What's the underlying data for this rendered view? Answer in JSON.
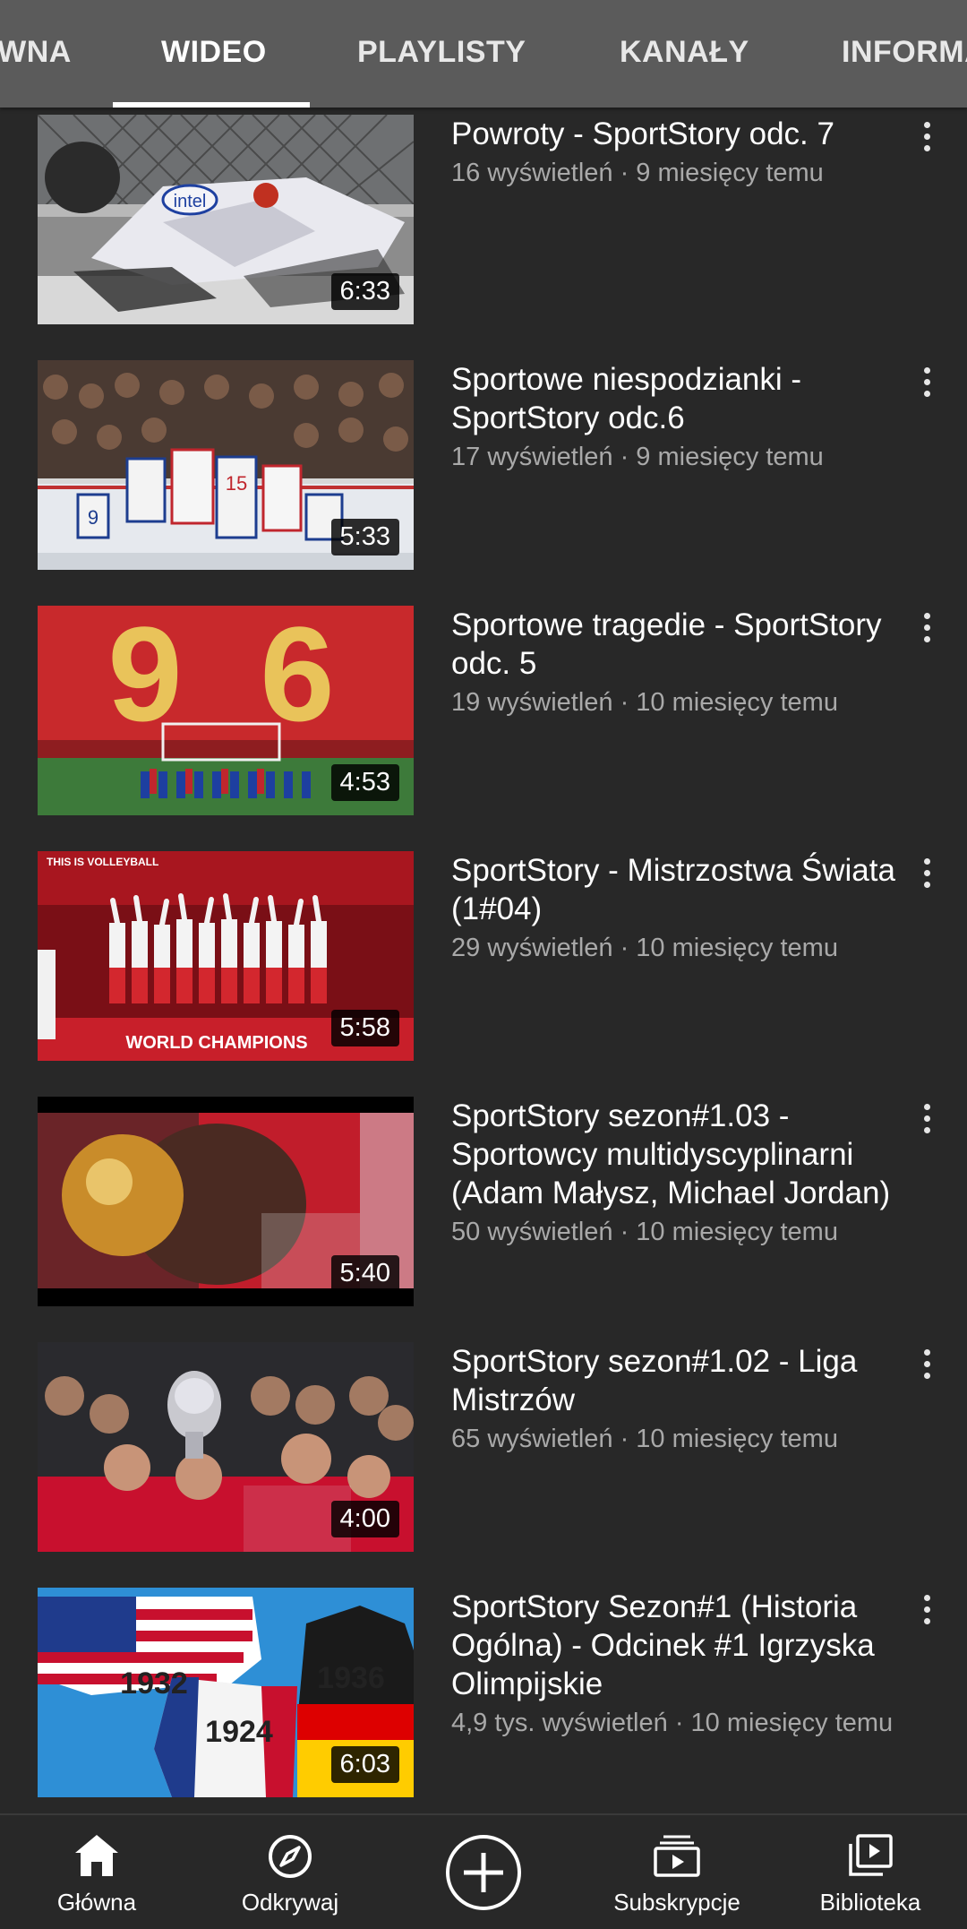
{
  "tabs": [
    {
      "label": "GŁÓWNA"
    },
    {
      "label": "WIDEO",
      "active": true
    },
    {
      "label": "PLAYLISTY"
    },
    {
      "label": "KANAŁY"
    },
    {
      "label": "INFORMACJE"
    }
  ],
  "videos": [
    {
      "title": "Powroty - SportStory odc. 7",
      "meta": "16 wyświetleń · 9 miesięcy temu",
      "duration": "6:33"
    },
    {
      "title": "Sportowe niespodzianki - SportStory odc.6",
      "meta": "17 wyświetleń · 9 miesięcy temu",
      "duration": "5:33"
    },
    {
      "title": "Sportowe tragedie - SportStory odc. 5",
      "meta": "19 wyświetleń · 10 miesięcy temu",
      "duration": "4:53"
    },
    {
      "title": "SportStory - Mistrzostwa Świata (1#04)",
      "meta": "29 wyświetleń · 10 miesięcy temu",
      "duration": "5:58"
    },
    {
      "title": "SportStory sezon#1.03 - Sportowcy multidyscyplinarni (Adam Małysz, Michael Jordan)",
      "meta": "50 wyświetleń · 10 miesięcy temu",
      "duration": "5:40"
    },
    {
      "title": "SportStory sezon#1.02 - Liga Mistrzów",
      "meta": "65 wyświetleń · 10 miesięcy temu",
      "duration": "4:00"
    },
    {
      "title": "SportStory Sezon#1 (Historia Ogólna) - Odcinek #1 Igrzyska Olimpijskie",
      "meta": "4,9 tys. wyświetleń · 10 miesięcy temu",
      "duration": "6:03"
    }
  ],
  "thumb_text": {
    "intel": "intel",
    "worldChampions": "WORLD CHAMPIONS",
    "volleyball": "THIS IS VOLLEYBALL",
    "y1932": "1932",
    "y1936": "1936",
    "y1924": "1924",
    "jersey9": "9",
    "jersey15": "15",
    "nine": "9",
    "six": "6"
  },
  "nav": [
    {
      "label": "Główna",
      "icon": "home-icon"
    },
    {
      "label": "Odkrywaj",
      "icon": "compass-icon"
    },
    {
      "label": "",
      "icon": "add-circle-icon"
    },
    {
      "label": "Subskrypcje",
      "icon": "subscriptions-icon"
    },
    {
      "label": "Biblioteka",
      "icon": "library-icon"
    }
  ],
  "colors": {
    "background": "#282828",
    "tabbar": "#5b5b5b",
    "text": "#ffffff",
    "secondary_text": "#a9a9a9"
  }
}
